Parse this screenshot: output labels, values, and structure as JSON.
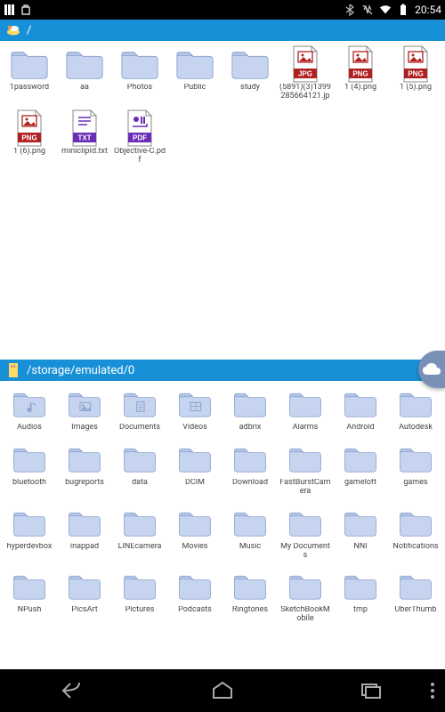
{
  "status": {
    "time": "20:54",
    "icons": [
      "bluetooth",
      "vibrate",
      "wifi",
      "battery"
    ]
  },
  "top_panel": {
    "path": "/",
    "icon": "cloud",
    "items": [
      {
        "type": "folder",
        "label": "1password"
      },
      {
        "type": "folder",
        "label": "aa"
      },
      {
        "type": "folder",
        "label": "Photos"
      },
      {
        "type": "folder",
        "label": "Public"
      },
      {
        "type": "folder",
        "label": "study"
      },
      {
        "type": "file",
        "ext": "JPG",
        "color": "#b02020",
        "label": "(5891)(3)1399285664121.jp"
      },
      {
        "type": "file",
        "ext": "PNG",
        "color": "#b02020",
        "label": "1 (4).png"
      },
      {
        "type": "file",
        "ext": "PNG",
        "color": "#b02020",
        "label": "1 (5).png"
      },
      {
        "type": "file",
        "ext": "PNG",
        "color": "#b02020",
        "label": "1 (6).png"
      },
      {
        "type": "file",
        "ext": "TXT",
        "color": "#6a2db5",
        "label": "miniclipId.txt"
      },
      {
        "type": "file",
        "ext": "PDF",
        "color": "#6a2db5",
        "label": "Objective-C.pdf"
      }
    ]
  },
  "bottom_panel": {
    "path": "/storage/emulated/0",
    "icon": "sd",
    "items": [
      {
        "type": "folder-media",
        "sub": "audio",
        "label": "Audios"
      },
      {
        "type": "folder-media",
        "sub": "image",
        "label": "Images"
      },
      {
        "type": "folder-media",
        "sub": "doc",
        "label": "Documents"
      },
      {
        "type": "folder-media",
        "sub": "video",
        "label": "Videos"
      },
      {
        "type": "folder",
        "label": "adbrix"
      },
      {
        "type": "folder",
        "label": "Alarms"
      },
      {
        "type": "folder",
        "label": "Android"
      },
      {
        "type": "folder",
        "label": "Autodesk"
      },
      {
        "type": "folder",
        "label": "bluetooth"
      },
      {
        "type": "folder",
        "label": "bugreports"
      },
      {
        "type": "folder",
        "label": "data"
      },
      {
        "type": "folder",
        "label": "DCIM"
      },
      {
        "type": "folder",
        "label": "Download"
      },
      {
        "type": "folder",
        "label": "FastBurstCamera"
      },
      {
        "type": "folder",
        "label": "gameloft"
      },
      {
        "type": "folder",
        "label": "games"
      },
      {
        "type": "folder",
        "label": "hyperdevbox"
      },
      {
        "type": "folder",
        "label": "inappad"
      },
      {
        "type": "folder",
        "label": "LINEcamera"
      },
      {
        "type": "folder",
        "label": "Movies"
      },
      {
        "type": "folder",
        "label": "Music"
      },
      {
        "type": "folder",
        "label": "My Documents"
      },
      {
        "type": "folder",
        "label": "NNI"
      },
      {
        "type": "folder",
        "label": "Notifications"
      },
      {
        "type": "folder",
        "label": "NPush"
      },
      {
        "type": "folder",
        "label": "PicsArt"
      },
      {
        "type": "folder",
        "label": "Pictures"
      },
      {
        "type": "folder",
        "label": "Podcasts"
      },
      {
        "type": "folder",
        "label": "Ringtones"
      },
      {
        "type": "folder",
        "label": "SketchBookMobile"
      },
      {
        "type": "folder",
        "label": "tmp"
      },
      {
        "type": "folder",
        "label": "UberThumb"
      }
    ]
  },
  "fab": {
    "icon": "cloud"
  }
}
